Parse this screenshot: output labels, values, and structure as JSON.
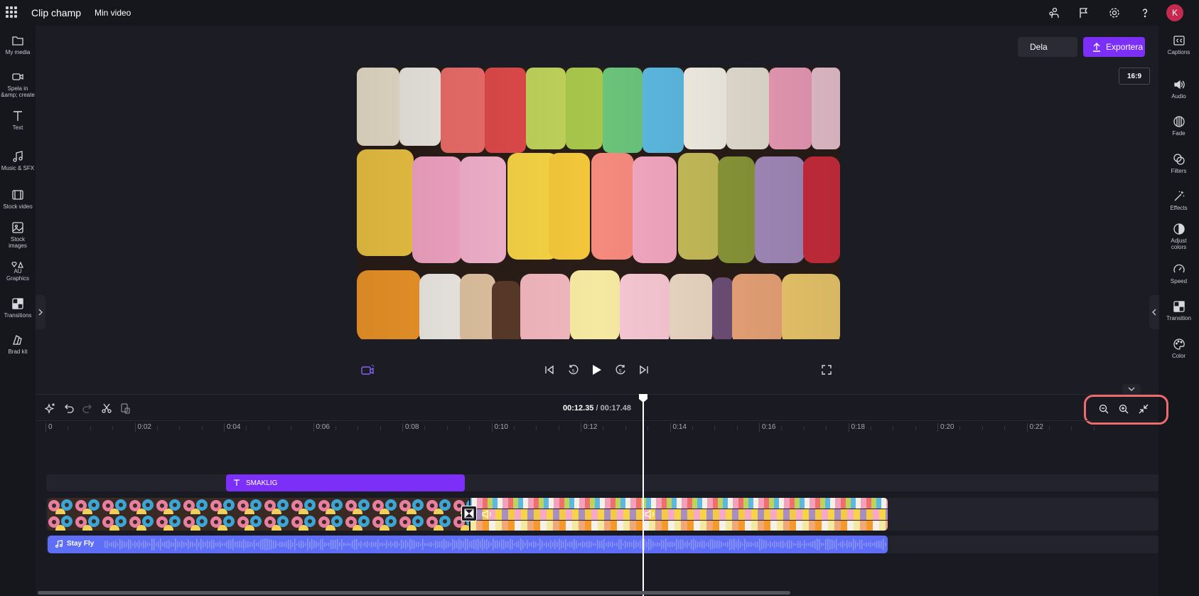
{
  "topbar": {
    "app_name": "Clip champ",
    "video_title": "Min video",
    "avatar_letter": "K",
    "icons": [
      "apps-grid-icon",
      "share-people-icon",
      "flag-icon",
      "settings-icon",
      "help-icon"
    ]
  },
  "left_sidebar": {
    "items": [
      {
        "label": "My media",
        "icon": "folder-icon"
      },
      {
        "label": "Spela in &amp; create",
        "icon": "camera-icon"
      },
      {
        "label": "Text",
        "icon": "text-icon"
      },
      {
        "label": "Music & SFX",
        "icon": "music-icon"
      },
      {
        "label": "Stock video",
        "icon": "film-icon"
      },
      {
        "label": "Stock images",
        "icon": "image-icon"
      },
      {
        "label": "Graphics",
        "icon": "graphics-icon",
        "glyph": "AU"
      },
      {
        "label": "Transitions",
        "icon": "transitions-icon"
      },
      {
        "label": "Brad kit",
        "icon": "brand-kit-icon"
      }
    ]
  },
  "right_sidebar": {
    "items": [
      {
        "label": "Captions",
        "icon": "captions-icon"
      },
      {
        "label": "Audio",
        "icon": "speaker-icon"
      },
      {
        "label": "Fade",
        "icon": "fade-icon"
      },
      {
        "label": "Filters",
        "icon": "filters-icon"
      },
      {
        "label": "Effects",
        "icon": "magic-wand-icon"
      },
      {
        "label": "Adjust colors",
        "icon": "contrast-icon"
      },
      {
        "label": "Speed",
        "icon": "speedometer-icon"
      },
      {
        "label": "Transition",
        "icon": "transition-icon"
      },
      {
        "label": "Color",
        "icon": "palette-icon"
      }
    ]
  },
  "preview": {
    "share_label": "Dela",
    "export_label": "Exportera",
    "aspect_ratio": "16:9",
    "image_description_icon": "macarons-photo"
  },
  "timeline": {
    "current_time": "00:12.35",
    "separator": " / ",
    "total_time": "00:17.48",
    "ruler_labels": [
      "0",
      "0:02",
      "0:04",
      "0:06",
      "0:08",
      "0:10",
      "0:12",
      "0:14",
      "0:16",
      "0:18",
      "0:20",
      "0:22"
    ],
    "text_clip_label": "SMAKLIG",
    "audio_clip_label": "Stay Fly",
    "playhead_time_seconds": 12.35
  },
  "colors": {
    "accent": "#7b2ff7",
    "audio": "#5f6ef7",
    "highlight": "#ef6b6b"
  }
}
